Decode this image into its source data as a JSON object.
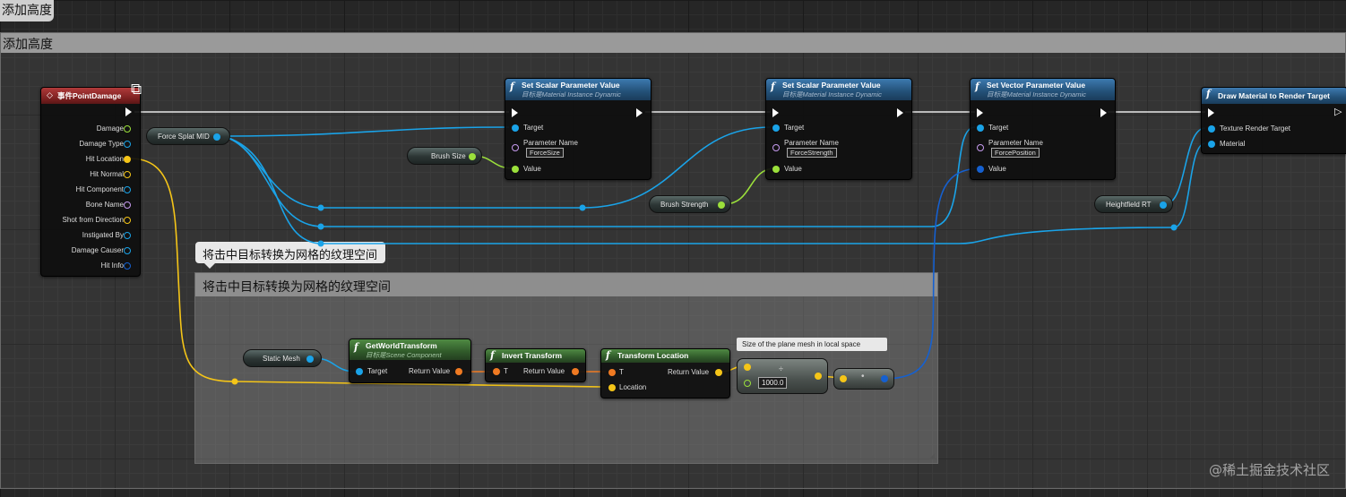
{
  "editor": {
    "tab_title": "添加高度"
  },
  "comments": {
    "outer": {
      "title": "添加高度"
    },
    "inner": {
      "title": "将击中目标转换为网格的纹理空间",
      "bubble": "将击中目标转换为网格的纹理空间"
    }
  },
  "event_node": {
    "title": "事件PointDamage",
    "pins": [
      "Damage",
      "Damage Type",
      "Hit Location",
      "Hit Normal",
      "Hit Component",
      "Bone Name",
      "Shot from Direction",
      "Instigated By",
      "Damage Causer",
      "Hit Info"
    ]
  },
  "variables": {
    "force_splat_mid": "Force Splat MID",
    "brush_size": "Brush Size",
    "brush_strength": "Brush Strength",
    "heightfield_rt": "Heightfield RT",
    "static_mesh": "Static Mesh"
  },
  "nodes": {
    "set_scalar_1": {
      "title": "Set Scalar Parameter Value",
      "subtitle": "目标是Material Instance Dynamic",
      "target": "Target",
      "param_label": "Parameter Name",
      "param_value": "ForceSize",
      "value": "Value"
    },
    "set_scalar_2": {
      "title": "Set Scalar Parameter Value",
      "subtitle": "目标是Material Instance Dynamic",
      "target": "Target",
      "param_label": "Parameter Name",
      "param_value": "ForceStrength",
      "value": "Value"
    },
    "set_vector": {
      "title": "Set Vector Parameter Value",
      "subtitle": "目标是Material Instance Dynamic",
      "target": "Target",
      "param_label": "Parameter Name",
      "param_value": "ForcePosition",
      "value": "Value"
    },
    "draw_material": {
      "title": "Draw Material to Render Target",
      "texture_rt": "Texture Render Target",
      "material": "Material"
    },
    "get_world_transform": {
      "title": "GetWorldTransform",
      "subtitle": "目标是Scene Component",
      "target": "Target",
      "return_value": "Return Value"
    },
    "invert_transform": {
      "title": "Invert Transform",
      "t": "T",
      "return_value": "Return Value"
    },
    "transform_location": {
      "title": "Transform Location",
      "t": "T",
      "location": "Location",
      "return_value": "Return Value"
    }
  },
  "divide_node": {
    "tooltip": "Size of the plane mesh in local space",
    "value": "1000.0",
    "operator": "÷"
  },
  "watermark": "@稀土掘金技术社区",
  "colors": {
    "exec": "#ffffff",
    "object_pin": "#1aa3e8",
    "float_pin": "#9be03b",
    "vector_pin": "#f5c518",
    "transform_pin": "#f07a22",
    "name_pin": "#c79bf0",
    "struct_pin": "#1560d0"
  }
}
